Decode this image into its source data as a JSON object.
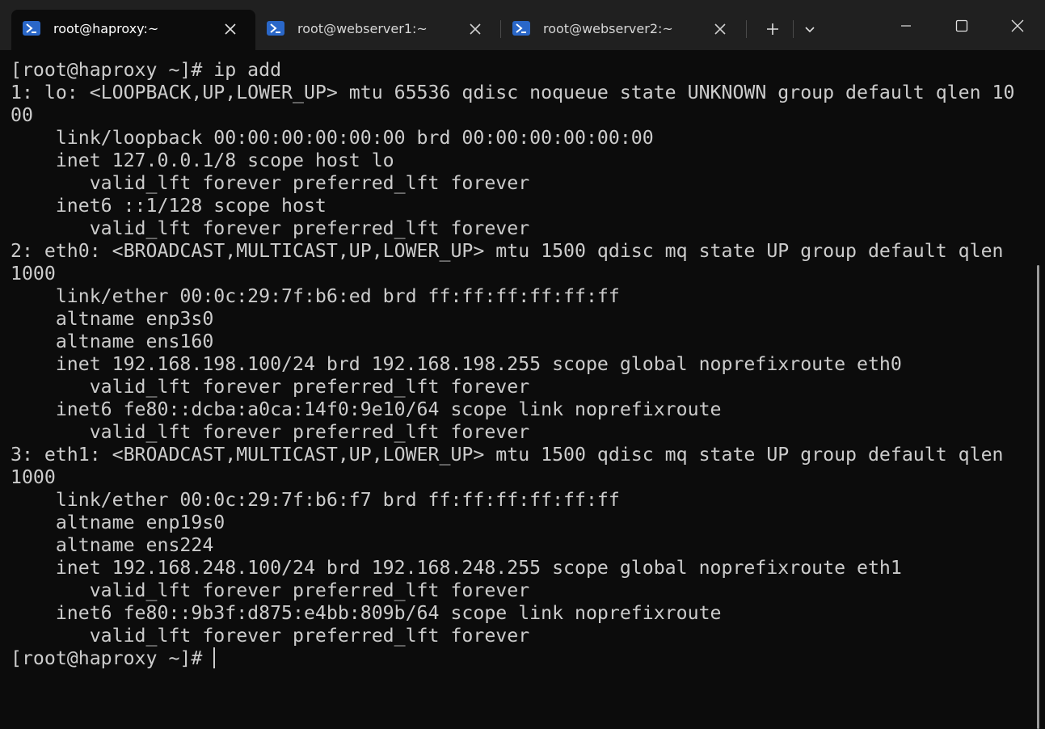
{
  "tabs": [
    {
      "label": "root@haproxy:~",
      "active": true
    },
    {
      "label": "root@webserver1:~",
      "active": false
    },
    {
      "label": "root@webserver2:~",
      "active": false
    }
  ],
  "icons": {
    "tab_icon": "powershell-terminal-icon",
    "close": "close-icon",
    "new_tab": "plus-icon",
    "dropdown": "chevron-down-icon",
    "minimize": "minimize-icon",
    "maximize": "maximize-icon",
    "window_close": "close-icon"
  },
  "colors": {
    "terminal_bg": "#0c0c0c",
    "titlebar_bg": "#202020",
    "text": "#cccccc",
    "tab_icon_bg": "#2a67c8"
  },
  "terminal": {
    "lines": [
      "[root@haproxy ~]# ip add",
      "1: lo: <LOOPBACK,UP,LOWER_UP> mtu 65536 qdisc noqueue state UNKNOWN group default qlen 10",
      "00",
      "    link/loopback 00:00:00:00:00:00 brd 00:00:00:00:00:00",
      "    inet 127.0.0.1/8 scope host lo",
      "       valid_lft forever preferred_lft forever",
      "    inet6 ::1/128 scope host",
      "       valid_lft forever preferred_lft forever",
      "2: eth0: <BROADCAST,MULTICAST,UP,LOWER_UP> mtu 1500 qdisc mq state UP group default qlen",
      "1000",
      "    link/ether 00:0c:29:7f:b6:ed brd ff:ff:ff:ff:ff:ff",
      "    altname enp3s0",
      "    altname ens160",
      "    inet 192.168.198.100/24 brd 192.168.198.255 scope global noprefixroute eth0",
      "       valid_lft forever preferred_lft forever",
      "    inet6 fe80::dcba:a0ca:14f0:9e10/64 scope link noprefixroute",
      "       valid_lft forever preferred_lft forever",
      "3: eth1: <BROADCAST,MULTICAST,UP,LOWER_UP> mtu 1500 qdisc mq state UP group default qlen",
      "1000",
      "    link/ether 00:0c:29:7f:b6:f7 brd ff:ff:ff:ff:ff:ff",
      "    altname enp19s0",
      "    altname ens224",
      "    inet 192.168.248.100/24 brd 192.168.248.255 scope global noprefixroute eth1",
      "       valid_lft forever preferred_lft forever",
      "    inet6 fe80::9b3f:d875:e4bb:809b/64 scope link noprefixroute",
      "       valid_lft forever preferred_lft forever",
      "[root@haproxy ~]# "
    ]
  }
}
